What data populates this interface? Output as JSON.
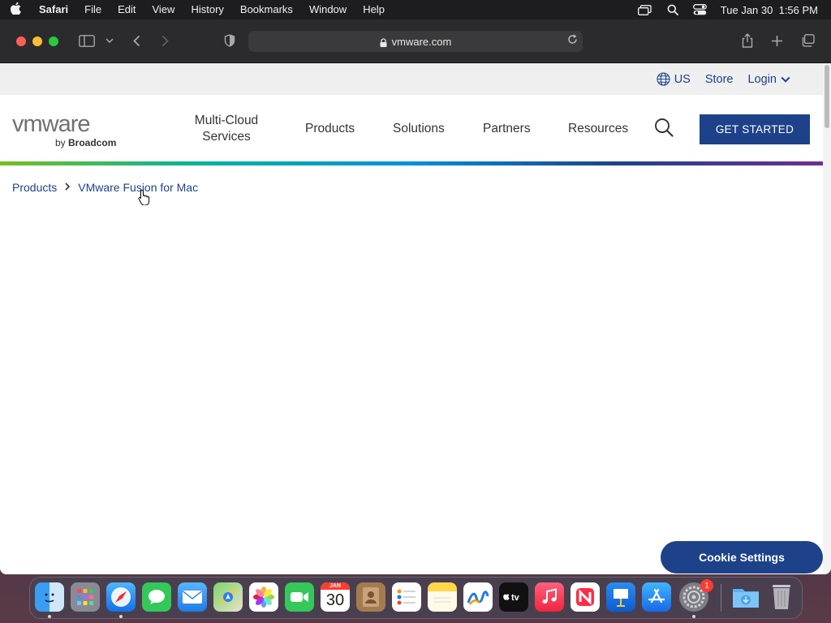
{
  "menubar": {
    "apple": "",
    "items": [
      "Safari",
      "File",
      "Edit",
      "View",
      "History",
      "Bookmarks",
      "Window",
      "Help"
    ],
    "clock": "Tue Jan 30  1:56 PM"
  },
  "browser": {
    "url": "vmware.com"
  },
  "utility": {
    "region": "US",
    "store": "Store",
    "login": "Login"
  },
  "logo": {
    "word": "vmware",
    "by": "by ",
    "brand": "Broadcom"
  },
  "nav": {
    "multicloud_line1": "Multi-Cloud",
    "multicloud_line2": "Services",
    "products": "Products",
    "solutions": "Solutions",
    "partners": "Partners",
    "resources": "Resources",
    "cta": "GET STARTED"
  },
  "breadcrumb": {
    "root": "Products",
    "current": "VMware Fusion for Mac"
  },
  "cookie": {
    "label": "Cookie Settings"
  },
  "dock": {
    "calendar_month": "JAN",
    "calendar_day": "30",
    "settings_badge": "1",
    "apps": [
      "finder-icon",
      "launchpad-icon",
      "safari-icon",
      "messages-icon",
      "mail-icon",
      "maps-icon",
      "photos-icon",
      "facetime-icon",
      "calendar-icon",
      "contacts-icon",
      "reminders-icon",
      "notes-icon",
      "freeform-icon",
      "apple-tv-icon",
      "music-icon",
      "news-icon",
      "keynote-icon",
      "app-store-icon",
      "system-settings-icon",
      "downloads-folder-icon",
      "trash-icon"
    ]
  },
  "colors": {
    "brand_blue": "#1d428a",
    "menubar_bg": "#1d1d1f",
    "toolbar_bg": "#2b2b2d"
  }
}
